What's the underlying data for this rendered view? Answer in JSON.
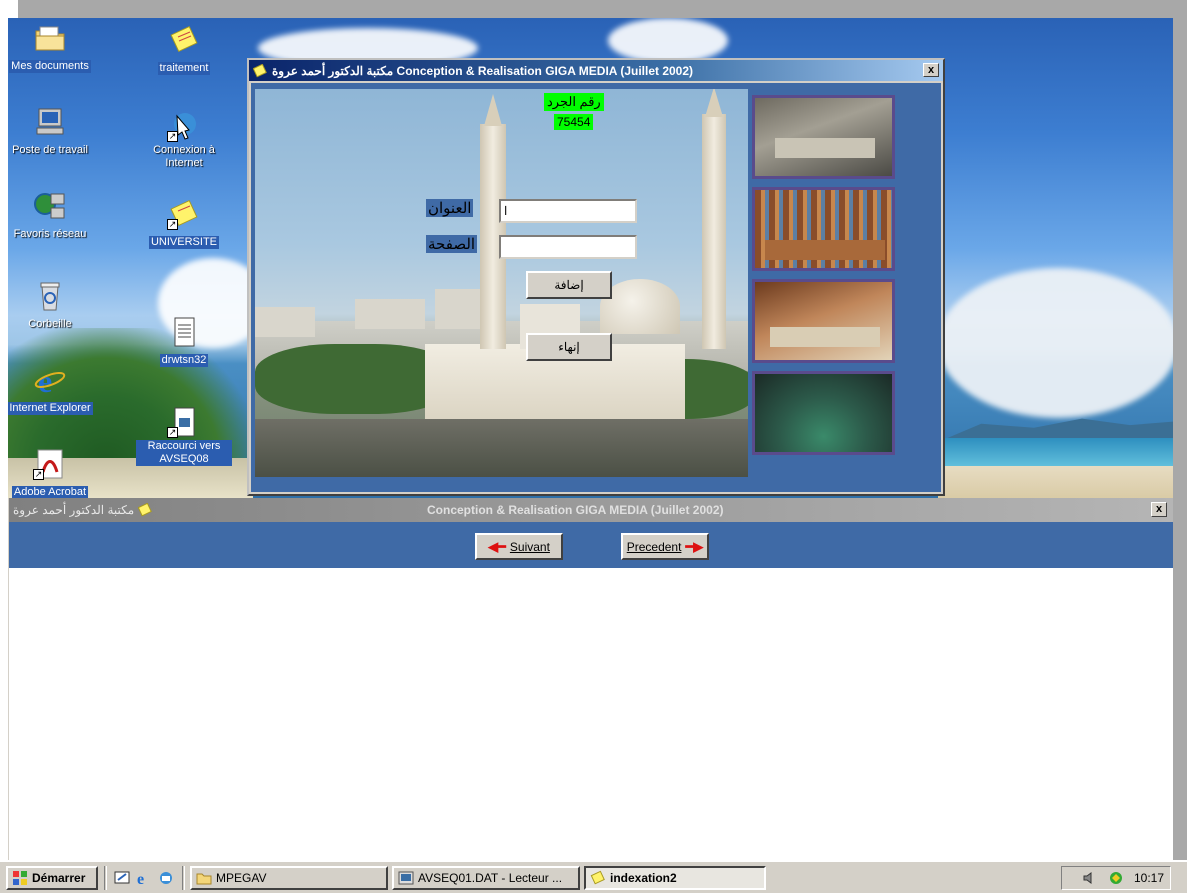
{
  "desktop": {
    "icons": [
      {
        "label": "Mes documents"
      },
      {
        "label": "traitement"
      },
      {
        "label": "Poste de travail"
      },
      {
        "label": "Connexion à Internet"
      },
      {
        "label": "Favoris réseau"
      },
      {
        "label": "UNIVERSITE"
      },
      {
        "label": "Corbeille"
      },
      {
        "label": "drwtsn32"
      },
      {
        "label": "Internet Explorer"
      },
      {
        "label": "Raccourci vers AVSEQ08"
      },
      {
        "label": "Adobe Acrobat"
      }
    ]
  },
  "app_window": {
    "title": "مكتبة الدكتور أحمد عروة Conception & Realisation GIGA MEDIA (Juillet 2002)",
    "close_label": "x",
    "record_label": "رقم الجرد",
    "record_number": "75454",
    "title_field_label": "العنوان",
    "title_field_value": "ا",
    "page_field_label": "الصفحة",
    "page_field_value": "",
    "add_button": "إضافة",
    "finish_button": "إنهاء"
  },
  "bottom_window": {
    "title": "Conception & Realisation GIGA MEDIA (Juillet 2002)",
    "title_ar": "مكتبة الدكتور أحمد عروة",
    "close_label": "x",
    "next_button": "Suivant",
    "prev_button": "Precedent"
  },
  "taskbar": {
    "start_label": "Démarrer",
    "tasks": [
      {
        "label": "MPEGAV"
      },
      {
        "label": "AVSEQ01.DAT - Lecteur ..."
      },
      {
        "label": "indexation2"
      }
    ],
    "clock": "10:17"
  },
  "colors": {
    "window_blue": "#3f6aa6",
    "titlebar_active": "#0a246a",
    "record_highlight": "#00ff00"
  }
}
